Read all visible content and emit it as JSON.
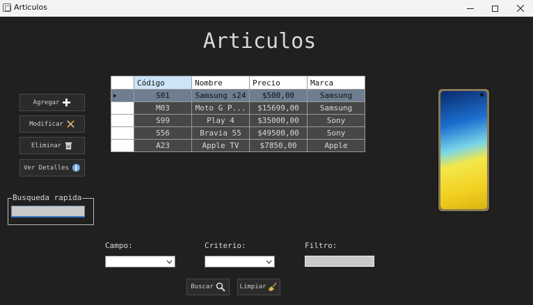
{
  "window": {
    "title": "Articulos"
  },
  "heading": "Articulos",
  "side_buttons": {
    "add": "Agregar",
    "modify": "Modificar",
    "delete": "Eliminar",
    "details": "Ver Detalles"
  },
  "grid": {
    "columns": [
      "Código",
      "Nombre",
      "Precio",
      "Marca"
    ],
    "selected_row": 0,
    "rows": [
      [
        "S01",
        "Samsung s24",
        "$500,00",
        "Samsung"
      ],
      [
        "M03",
        "Moto G P...",
        "$15699,00",
        "Samsung"
      ],
      [
        "S99",
        "Play 4",
        "$35000,00",
        "Sony"
      ],
      [
        "S56",
        "Bravia 55",
        "$49500,00",
        "Sony"
      ],
      [
        "A23",
        "Apple TV",
        "$7850,00",
        "Apple"
      ]
    ]
  },
  "quick_search": {
    "label": "Busqueda rapida",
    "value": ""
  },
  "filters": {
    "campo_label": "Campo:",
    "criterio_label": "Criterio:",
    "filtro_label": "Filtro:",
    "campo_value": "",
    "criterio_value": "",
    "filtro_value": ""
  },
  "actions": {
    "search": "Buscar",
    "clear": "Limpiar"
  },
  "colors": {
    "background": "#202020",
    "grid_cell": "#474747",
    "grid_selected": "#6e7e90",
    "header_selected": "#cde3f7"
  }
}
